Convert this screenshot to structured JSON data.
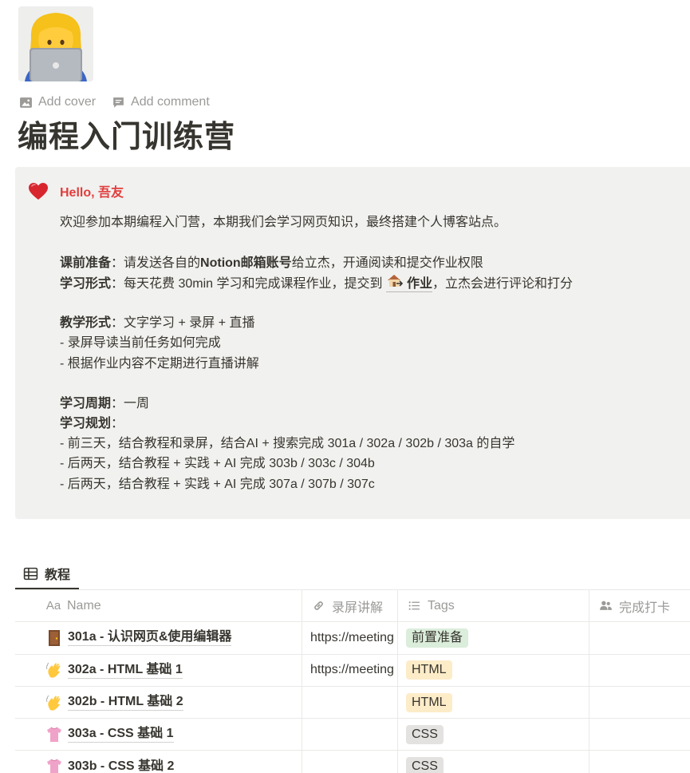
{
  "page": {
    "icon": "woman-technologist-emoji",
    "add_cover": "Add cover",
    "add_comment": "Add comment",
    "title": "编程入门训练营"
  },
  "callout": {
    "icon": "red-heart-emoji",
    "greeting": "Hello, 吾友",
    "intro": "欢迎参加本期编程入门营，本期我们会学习网页知识，最终搭建个人博客站点。",
    "prep_label": "课前准备",
    "prep_text_1": "：请发送各自的",
    "prep_bold": "Notion邮箱账号",
    "prep_text_2": "给立杰，开通阅读和提交作业权限",
    "form_label": "学习形式",
    "form_text_1": "：每天花费 30min 学习和完成课程作业，提交到",
    "form_link": "作业",
    "form_text_2": "，立杰会进行评论和打分",
    "teach_label": "教学形式",
    "teach_text": "：文字学习 +  录屏 + 直播",
    "teach_item_1": "- 录屏导读当前任务如何完成",
    "teach_item_2": "- 根据作业内容不定期进行直播讲解",
    "period_label": "学习周期",
    "period_text": "：一周",
    "plan_label": "学习规划",
    "plan_colon": "：",
    "plan_item_1": "- 前三天，结合教程和录屏，结合AI + 搜索完成 301a / 302a / 302b / 303a 的自学",
    "plan_item_2": "- 后两天，结合教程 + 实践 + AI 完成  303b / 303c / 304b",
    "plan_item_3": "- 后两天，结合教程 + 实践 + AI 完成  307a / 307b / 307c"
  },
  "database": {
    "tab_label": "教程",
    "columns": {
      "name": "Name",
      "name_icon_text": "Aa",
      "recording": "录屏讲解",
      "tags": "Tags",
      "checkin": "完成打卡"
    },
    "rows": [
      {
        "emoji": "door",
        "name": "301a - 认识网页&使用编辑器",
        "url": "https://meeting",
        "tag": "前置准备",
        "tag_color": "#dbeddb"
      },
      {
        "emoji": "wave",
        "name": "302a - HTML 基础 1",
        "url": "https://meeting",
        "tag": "HTML",
        "tag_color": "#fdecc8"
      },
      {
        "emoji": "wave",
        "name": "302b - HTML 基础 2",
        "url": "",
        "tag": "HTML",
        "tag_color": "#fdecc8"
      },
      {
        "emoji": "shirt",
        "name": "303a - CSS 基础 1",
        "url": "",
        "tag": "CSS",
        "tag_color": "#e3e2e0"
      },
      {
        "emoji": "shirt",
        "name": "303b - CSS 基础 2",
        "url": "",
        "tag": "CSS",
        "tag_color": "#e3e2e0"
      }
    ]
  }
}
